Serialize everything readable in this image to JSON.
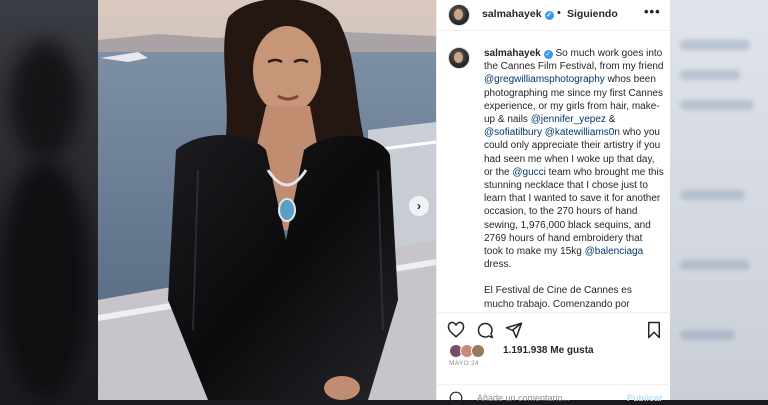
{
  "header": {
    "username": "salmahayek",
    "follow_label": "Siguiendo",
    "more_label": "•••"
  },
  "caption": {
    "username": "salmahayek",
    "lines_1": "So much work goes into the Cannes Film Festival, from my friend",
    "mention_greg": "@gregwilliamsphotography",
    "lines_2": "whos been photographing me since my first Cannes experience, or my girls from hair, make-up & nails",
    "mention_jennifer": "@jennifer_yepez",
    "amp": "&",
    "mention_sofia": "@sofiatilbury",
    "mention_kate": "@katewilliams0n",
    "lines_3": "who you could only appreciate their artistry if you had seen me when I woke up that day, or the",
    "mention_gucci": "@gucci",
    "lines_4": "team who brought me this stunning necklace that I chose just to learn that I wanted to save it for another occasion, to the 270 hours of hand sewing, 1,976,000 black sequins, and 2769 hours of hand embroidery that took to make my 15kg",
    "mention_balenciaga": "@balenciaga",
    "lines_5": "dress.",
    "spanish": "El Festival de Cine de Cannes es mucho trabajo. Comenzando por"
  },
  "engagement": {
    "likes": "1.191.938 Me gusta",
    "date": "MAYO 24"
  },
  "comment": {
    "placeholder": "Añade un comentario...",
    "publish_label": "Publicar"
  },
  "icons": [
    "verified-icon",
    "more-options-icon",
    "heart-icon",
    "comment-icon",
    "share-icon",
    "bookmark-icon",
    "emoji-icon",
    "carousel-next-icon"
  ],
  "colors": {
    "mention": "#00376b",
    "verified": "#3897f0",
    "text": "#262626",
    "muted": "#8e8e8e",
    "publish": "#b2dffc"
  }
}
